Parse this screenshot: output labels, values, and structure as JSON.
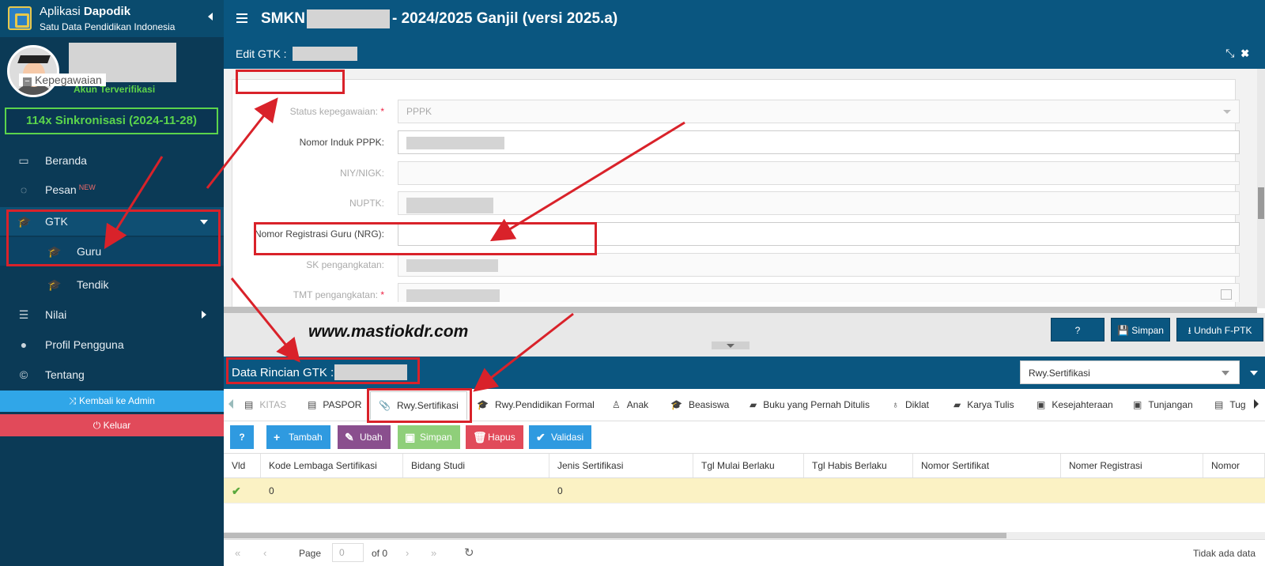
{
  "brand": {
    "title_pre": "Aplikasi ",
    "title_bold": "Dapodik",
    "subtitle": "Satu Data Pendidikan Indonesia"
  },
  "user": {
    "status": "Akun Terverifikasi"
  },
  "sync": {
    "label": "114x Sinkronisasi (2024-11-28)"
  },
  "menu": {
    "beranda": "Beranda",
    "pesan": "Pesan",
    "pesan_badge": "NEW",
    "gtk": "GTK",
    "guru": "Guru",
    "tendik": "Tendik",
    "nilai": "Nilai",
    "profil": "Profil Pengguna",
    "tentang": "Tentang"
  },
  "buttons": {
    "admin": "Kembali ke Admin",
    "logout": "Keluar"
  },
  "topbar": {
    "title_prefix": "SMKN",
    "title_suffix": "- 2024/2025 Ganjil (versi 2025.a)"
  },
  "edit": {
    "title": "Edit GTK :"
  },
  "form": {
    "legend": "Kepegawaian",
    "status_label": "Status kepegawaian:",
    "status_value": "PPPK",
    "nip_pppk_label": "Nomor Induk PPPK:",
    "niy_label": "NIY/NIGK:",
    "nuptk_label": "NUPTK:",
    "nrg_label": "Nomor Registrasi Guru (NRG):",
    "sk_label": "SK pengangkatan:",
    "tmt_label": "TMT pengangkatan:"
  },
  "actions": {
    "help": "?",
    "save": "Simpan",
    "download": "Unduh F-PTK"
  },
  "watermark": "www.mastiokdr.com",
  "detail": {
    "title": "Data Rincian GTK :",
    "combo_value": "Rwy.Sertifikasi"
  },
  "tabs": [
    "KITAS",
    "PASPOR",
    "Rwy.Sertifikasi",
    "Rwy.Pendidikan Formal",
    "Anak",
    "Beasiswa",
    "Buku yang Pernah Ditulis",
    "Diklat",
    "Karya Tulis",
    "Kesejahteraan",
    "Tunjangan",
    "Tug"
  ],
  "toolbar": {
    "help": "?",
    "add": "Tambah",
    "edit": "Ubah",
    "save": "Simpan",
    "delete": "Hapus",
    "validate": "Validasi"
  },
  "grid": {
    "columns": [
      "Vld",
      "Kode Lembaga Sertifikasi",
      "Bidang Studi",
      "Jenis Sertifikasi",
      "Tgl Mulai Berlaku",
      "Tgl Habis Berlaku",
      "Nomor Sertifikat",
      "Nomer Registrasi",
      "Nomor"
    ],
    "rows": [
      {
        "kode": "0",
        "jenis": "0"
      }
    ]
  },
  "pager": {
    "page_label": "Page",
    "page_value": "0",
    "of_label": "of 0",
    "no_data": "Tidak ada data"
  },
  "colors": {
    "sidebar": "#0b3a56",
    "header": "#0a5680",
    "accent_green": "#5bd44c",
    "annotation_red": "#d9222a"
  }
}
